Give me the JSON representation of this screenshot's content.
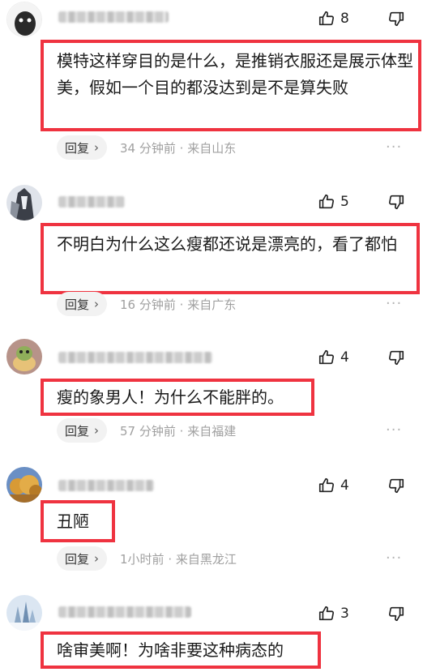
{
  "comments": [
    {
      "likes": "8",
      "text": "模特这样穿目的是什么，是推销衣服还是展示体型美，假如一个目的都没达到是不是算失败",
      "reply_label": "回复",
      "time": "34 分钟前",
      "location": "来自山东"
    },
    {
      "likes": "5",
      "text": "不明白为什么这么瘦都还说是漂亮的，看了都怕",
      "reply_label": "回复",
      "time": "16 分钟前",
      "location": "来自广东"
    },
    {
      "likes": "4",
      "text": "瘦的象男人！为什么不能胖的。",
      "reply_label": "回复",
      "time": "57 分钟前",
      "location": "来自福建"
    },
    {
      "likes": "4",
      "text": "丑陋",
      "reply_label": "回复",
      "time": "1小时前",
      "location": "来自黑龙江"
    },
    {
      "likes": "3",
      "text": "啥审美啊！为啥非要这种病态的"
    }
  ],
  "meta_separator": " · ",
  "reply_chevron": "›",
  "more_glyph": "···",
  "colors": {
    "highlight_border": "#ef3340",
    "meta_gray": "#a0a0a0"
  }
}
